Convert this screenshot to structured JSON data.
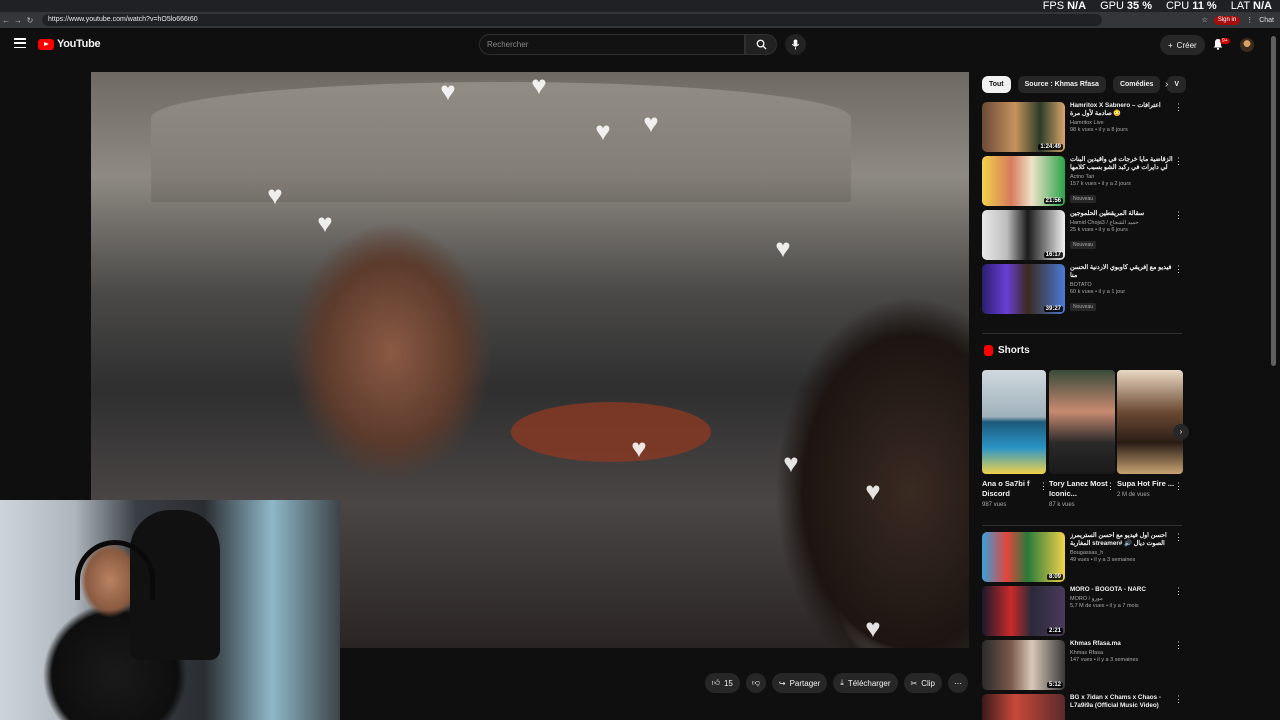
{
  "browser": {
    "url": "https://www.youtube.com/watch?v=hO5lo666t60",
    "signin": "Sign in",
    "chat": "Chat"
  },
  "stats": {
    "fps_label": "FPS",
    "fps": "N/A",
    "gpu_label": "GPU",
    "gpu": "35 %",
    "cpu_label": "CPU",
    "cpu": "11 %",
    "lat_label": "LAT",
    "lat": "N/A"
  },
  "header": {
    "logo": "YouTube",
    "search_placeholder": "Rechercher",
    "create": "Créer",
    "notif_badge": "9+"
  },
  "actions": {
    "likes": "15",
    "share": "Partager",
    "download": "Télécharger",
    "clip": "Clip"
  },
  "chips": [
    "Tout",
    "Source : Khmas Rfasa",
    "Comédies",
    "V"
  ],
  "reco_top": [
    {
      "title": "Hamritox X Sabnero – اعترافات صادمة لأول مرة 😳",
      "channel": "Hamritox Live",
      "meta": "98 k vues • il y a 8 jours",
      "duration": "1:24:49",
      "badge": ""
    },
    {
      "title": "الزقاضية مايا خرجات في واقيدين البنات لي دايرات في ركبد الشو بسبب كلامها على عمها",
      "channel": "Actno Tari",
      "meta": "157 k vues • il y a 2 jours",
      "duration": "21:56",
      "badge": "Nouveau"
    },
    {
      "title": "سقالة المريقطين الحلموجين",
      "channel": "Hamid Choja3 / حميد الشجاع",
      "meta": "25 k vues • il y a 6 jours",
      "duration": "16:17",
      "badge": "Nouveau"
    },
    {
      "title": "فيديو مع إفريقي كاوبوي الاردنية الحسن منا",
      "channel": "BOTATO",
      "meta": "60 k vues • il y a 1 jour",
      "duration": "39:27",
      "badge": "Nouveau"
    }
  ],
  "shorts": {
    "title": "Shorts",
    "items": [
      {
        "title": "Ana o Sa7bi f Discord",
        "views": "987 vues"
      },
      {
        "title": "Tory Lanez Most Iconic...",
        "views": "87 k vues"
      },
      {
        "title": "Supa Hot Fire ...",
        "views": "2 M de vues"
      }
    ]
  },
  "reco_bottom": [
    {
      "title": "أحسن أول فيديو مع أحسن الستريمرز المغاربة streamer# 🔊 الصوت ديال الضحك ...",
      "channel": "Bougassas_h",
      "meta": "49 vues • il y a 3 semaines",
      "duration": "8:09",
      "badge": ""
    },
    {
      "title": "MORO - BOGOTA - NARC",
      "channel": "MORO / مورو",
      "meta": "5,7 M de vues • il y a 7 mois",
      "duration": "2:21",
      "badge": ""
    },
    {
      "title": "Khmas Rfasa.ma",
      "channel": "Khmas Rfasa",
      "meta": "147 vues • il y a 3 semaines",
      "duration": "5:12",
      "badge": ""
    },
    {
      "title": "BG x 7idan x Chams x Chaos - L7a9i9a (Official Music Video)",
      "channel": "",
      "meta": "",
      "duration": "",
      "badge": ""
    }
  ]
}
